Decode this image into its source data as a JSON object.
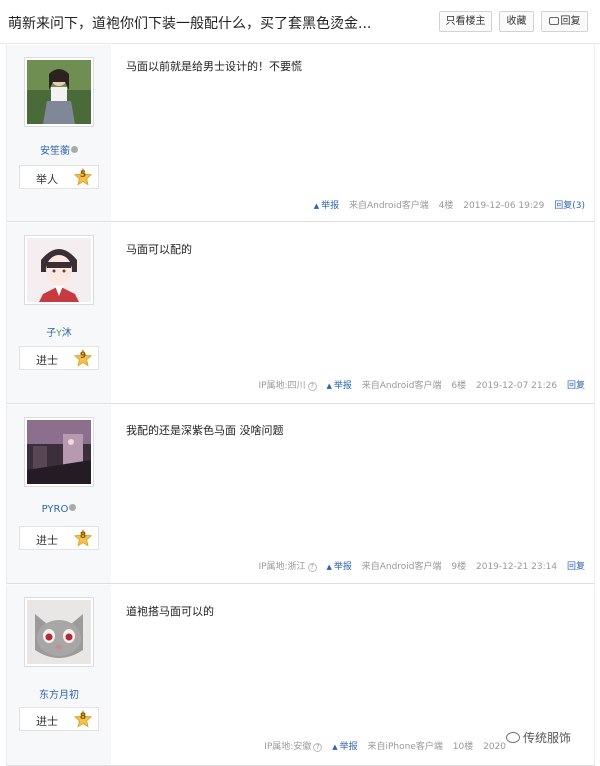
{
  "header": {
    "title": "萌新来问下，道袍你们下装一般配什么，买了套黑色烫金...",
    "only_author": "只看楼主",
    "favorite": "收藏",
    "reply": "回复"
  },
  "posts": [
    {
      "username": "安笙蘅",
      "level_name": "举人",
      "level": "5",
      "content": "马面以前就是给男士设计的！不要慌",
      "ip": "",
      "report": "举报",
      "client": "来自Android客户端",
      "floor": "4楼",
      "time": "2019-12-06 19:29",
      "reply_label": "回复(3)"
    },
    {
      "username": "子",
      "username_suffix": "沐",
      "level_name": "进士",
      "level": "9",
      "content": "马面可以配的",
      "ip": "IP属地:四川",
      "report": "举报",
      "client": "来自Android客户端",
      "floor": "6楼",
      "time": "2019-12-07 21:26",
      "reply_label": "回复"
    },
    {
      "username": "PYRO",
      "level_name": "进士",
      "level": "8",
      "content": "我配的还是深紫色马面 没啥问题",
      "ip": "IP属地:浙江",
      "report": "举报",
      "client": "来自Android客户端",
      "floor": "9楼",
      "time": "2019-12-21 23:14",
      "reply_label": "回复"
    },
    {
      "username": "东方月初",
      "level_name": "进士",
      "level": "8",
      "content": "道袍搭马面可以的",
      "ip": "IP属地:安徽",
      "report": "举报",
      "client": "来自iPhone客户端",
      "floor": "10楼",
      "time": "2020",
      "reply_label": ""
    }
  ],
  "watermark": "传统服饰",
  "colors": {
    "link": "#2d64b3",
    "muted": "#999999",
    "side_bg": "#f7f8fa",
    "star": "#f2c14e"
  }
}
